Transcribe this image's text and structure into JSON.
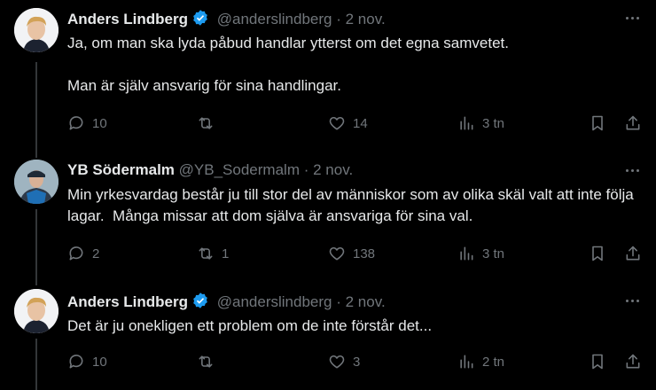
{
  "tweets": [
    {
      "name": "Anders Lindberg",
      "handle": "@anderslindberg",
      "sep": "·",
      "date": "2 nov.",
      "verified": true,
      "text": "Ja, om man ska lyda påbud handlar ytterst om det egna samvetet.\n\nMan är själv ansvarig för sina handlingar.",
      "replies": "10",
      "retweets": "",
      "likes": "14",
      "views": "3 tn"
    },
    {
      "name": "YB Södermalm",
      "handle": "@YB_Sodermalm",
      "sep": "·",
      "date": "2 nov.",
      "verified": false,
      "text": "Min yrkesvardag består ju till stor del av människor som av olika skäl valt att inte följa lagar.  Många missar att dom själva är ansvariga för sina val.",
      "replies": "2",
      "retweets": "1",
      "likes": "138",
      "views": "3 tn"
    },
    {
      "name": "Anders Lindberg",
      "handle": "@anderslindberg",
      "sep": "·",
      "date": "2 nov.",
      "verified": true,
      "text": "Det är ju onekligen ett problem om de inte förstår det...",
      "replies": "10",
      "retweets": "",
      "likes": "3",
      "views": "2 tn"
    }
  ],
  "colors": {
    "background": "#000000",
    "text": "#e7e9ea",
    "muted": "#71767b",
    "verified": "#1d9bf0",
    "thread_line": "#333639"
  },
  "icons": [
    "reply-icon",
    "retweet-icon",
    "like-icon",
    "views-icon",
    "bookmark-icon",
    "share-icon",
    "more-icon",
    "verified-icon"
  ]
}
